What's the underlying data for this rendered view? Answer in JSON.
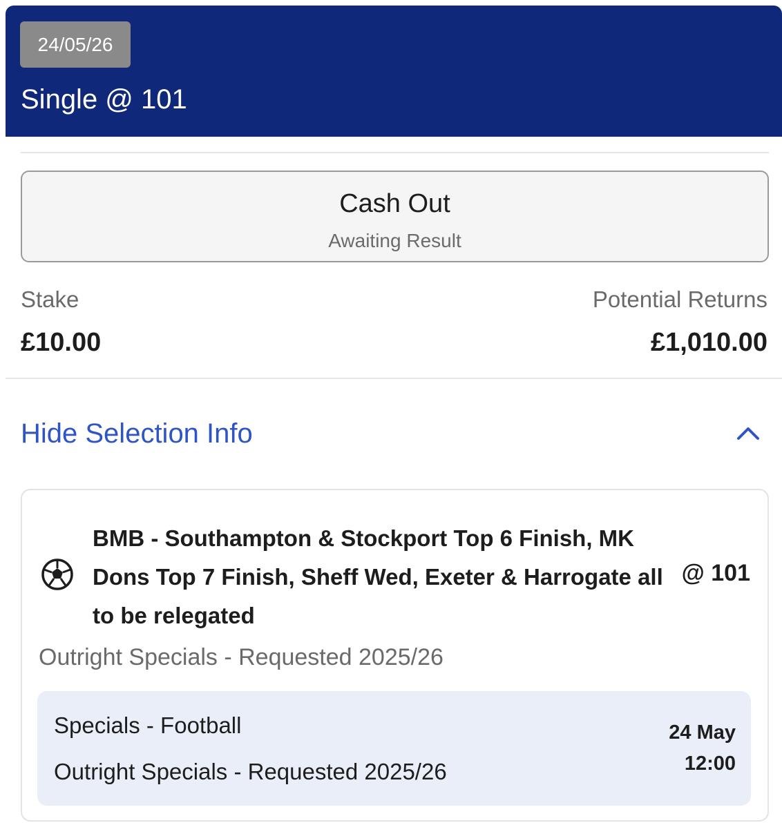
{
  "header": {
    "date": "24/05/26",
    "bet_type": "Single @ 101"
  },
  "cashout": {
    "title": "Cash Out",
    "status": "Awaiting Result"
  },
  "amounts": {
    "stake_label": "Stake",
    "stake_value": "£10.00",
    "returns_label": "Potential Returns",
    "returns_value": "£1,010.00"
  },
  "selection_toggle": {
    "label": "Hide Selection Info",
    "icon": "chevron-up-icon"
  },
  "selection": {
    "sport_icon": "football-icon",
    "name": "BMB - Southampton & Stockport Top 6 Finish, MK Dons Top 7 Finish, Sheff Wed, Exeter & Harrogate all to be relegated",
    "odds": "@ 101",
    "market": "Outright Specials - Requested  2025/26"
  },
  "event": {
    "sport": "Specials - Football",
    "market": "Outright Specials - Requested 2025/26",
    "date": "24 May",
    "time": "12:00"
  },
  "colors": {
    "header_bg": "#0f287a",
    "badge_bg": "#8a8a8a",
    "link_blue": "#2f55c4",
    "event_panel_bg": "#e9eef9"
  }
}
